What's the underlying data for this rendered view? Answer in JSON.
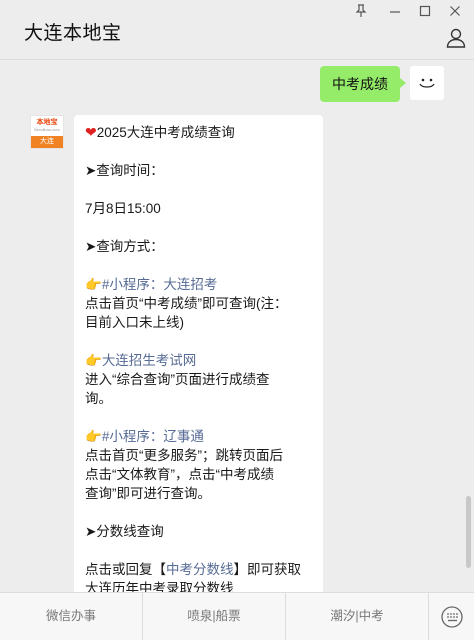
{
  "window": {
    "title": "大连本地宝",
    "controls": {
      "pin": "pin-icon",
      "minimize": "minimize-icon",
      "maximize": "maximize-icon",
      "close": "close-icon"
    }
  },
  "avatar": {
    "brand": "本地宝",
    "domain": "Bendibao.com",
    "city": "大连"
  },
  "chat": {
    "sent_message": "中考成绩",
    "reply": {
      "title": "2025大连中考成绩查询",
      "query_time_label": "➤查询时间：",
      "query_time_value": "7月8日15:00",
      "query_method_label": "➤查询方式：",
      "m1_tag": "#小程序：大连招考",
      "m1_desc1": "点击首页“中考成绩”即可查询(注：",
      "m1_desc2": "目前入口未上线)",
      "m2_link": "大连招生考试网",
      "m2_desc1": "进入“综合查询”页面进行成绩查",
      "m2_desc2": "询。",
      "m3_tag": "#小程序：辽事通",
      "m3_desc1": "点击首页“更多服务”；跳转页面后",
      "m3_desc2": "点击“文体教育”，点击“中考成绩",
      "m3_desc3": "查询”即可进行查询。",
      "score_line_label": "➤分数线查询",
      "score_pre": "点击或回复【",
      "score_link": "中考分数线",
      "score_post": "】即可获取",
      "score_line2": "大连历年中考录取分数线"
    }
  },
  "bottom_menu": {
    "item1": "微信办事",
    "item2": "喷泉|船票",
    "item3": "潮汐|中考"
  }
}
